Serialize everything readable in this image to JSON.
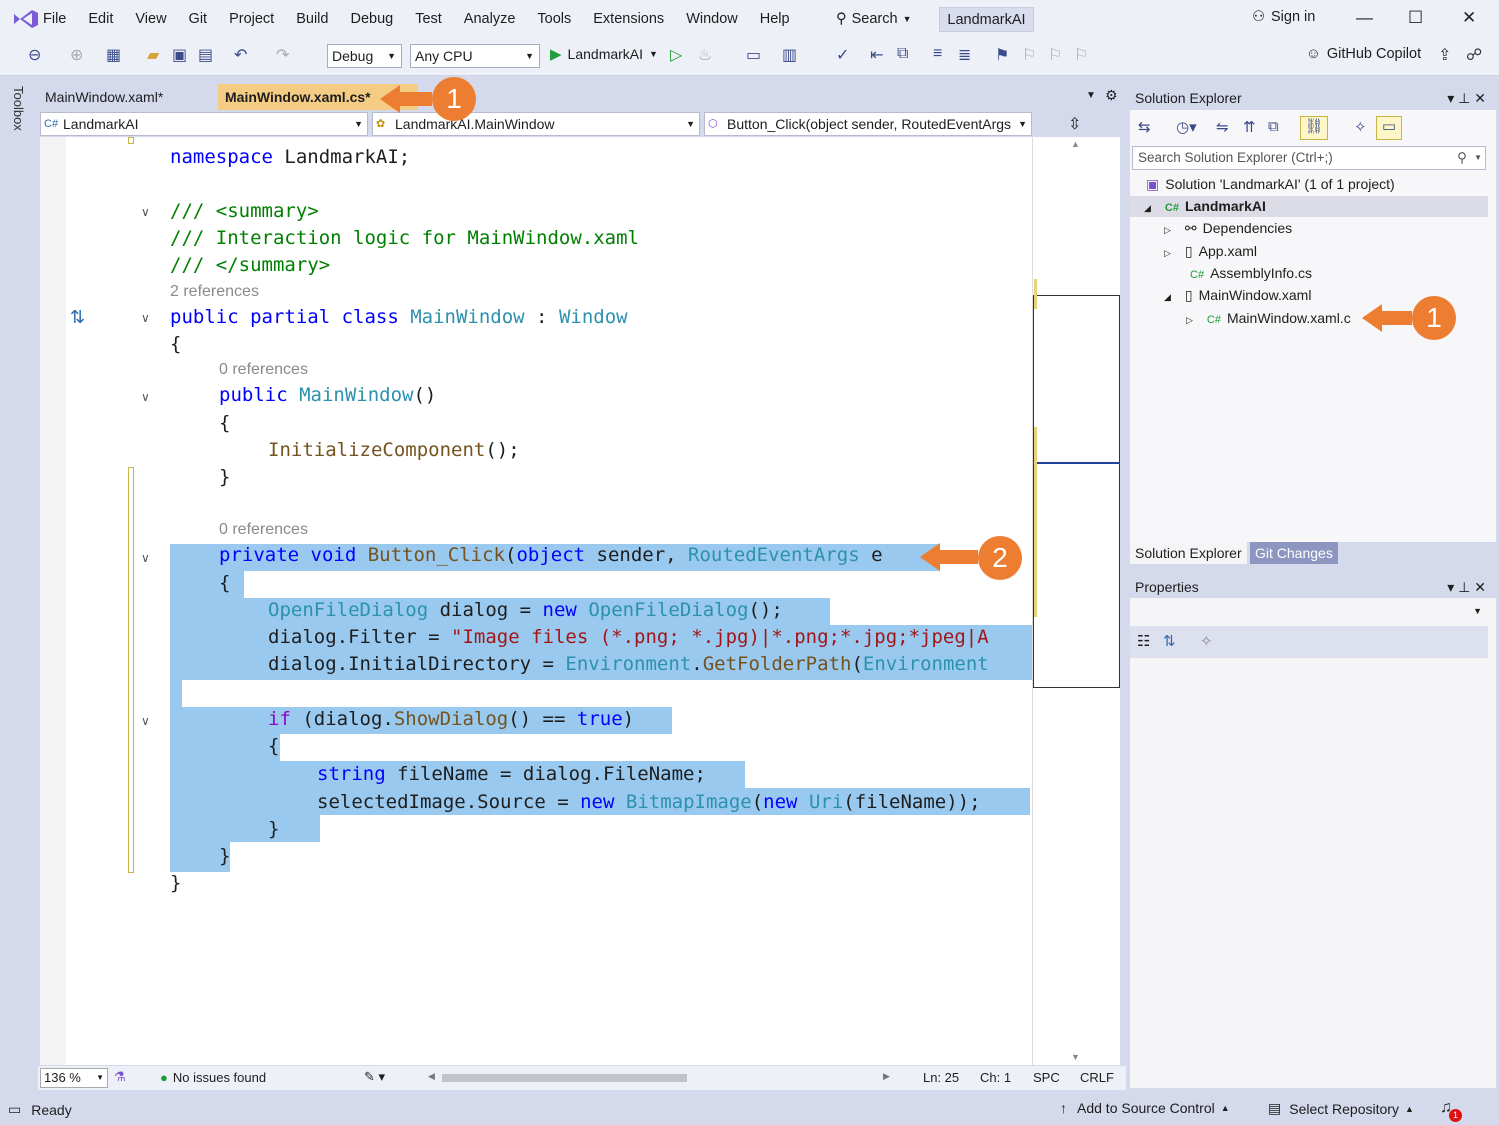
{
  "menu": [
    "File",
    "Edit",
    "View",
    "Git",
    "Project",
    "Build",
    "Debug",
    "Test",
    "Analyze",
    "Tools",
    "Extensions",
    "Window",
    "Help"
  ],
  "search_label": "Search",
  "solution_name": "LandmarkAI",
  "sign_in": "Sign in",
  "toolbar": {
    "config": "Debug",
    "platform": "Any CPU",
    "run_target": "LandmarkAI",
    "copilot": "GitHub Copilot"
  },
  "toolbox_label": "Toolbox",
  "tabs": [
    {
      "label": "MainWindow.xaml*"
    },
    {
      "label": "MainWindow.xaml.cs*"
    }
  ],
  "nav": {
    "project": "LandmarkAI",
    "type": "LandmarkAI.MainWindow",
    "member": "Button_Click(object sender, RoutedEventArgs"
  },
  "code": {
    "l1": [
      "namespace ",
      "LandmarkAI;"
    ],
    "l2": "/// <summary>",
    "l3": "/// Interaction logic for MainWindow.xaml",
    "l4": "/// </summary>",
    "ref2": "2 references",
    "l5": [
      "public partial class ",
      "MainWindow",
      " : ",
      "Window"
    ],
    "brace_open": "{",
    "brace_close": "}",
    "ref0a": "0 references",
    "l6": [
      "public ",
      "MainWindow",
      "()"
    ],
    "l7": [
      "InitializeComponent",
      "();"
    ],
    "ref0b": "0 references",
    "l8": [
      "private void ",
      "Button_Click",
      "(",
      "object",
      " sender, ",
      "RoutedEventArgs",
      " e"
    ],
    "l9": [
      "OpenFileDialog",
      " dialog = ",
      "new ",
      "OpenFileDialog",
      "();"
    ],
    "l10": [
      "dialog.Filter = ",
      "\"Image files (*.png; *.jpg)|*.png;*.jpg;*jpeg|A"
    ],
    "l11": [
      "dialog.InitialDirectory = ",
      "Environment",
      ".",
      "GetFolderPath",
      "(",
      "Environment"
    ],
    "l12": [
      "if",
      " (dialog.",
      "ShowDialog",
      "() == ",
      "true",
      ")"
    ],
    "l13": [
      "string",
      " fileName = dialog.FileName;"
    ],
    "l14": [
      "selectedImage.Source = ",
      "new ",
      "BitmapImage",
      "(",
      "new ",
      "Uri",
      "(fileName));"
    ]
  },
  "editor_status": {
    "zoom": "136 %",
    "issues": "No issues found",
    "ln": "Ln: 25",
    "ch": "Ch: 1",
    "spc": "SPC",
    "crlf": "CRLF"
  },
  "status": {
    "ready": "Ready",
    "add_source": "Add to Source Control",
    "select_repo": "Select Repository",
    "notif_count": "1"
  },
  "solution_explorer": {
    "title": "Solution Explorer",
    "search_placeholder": "Search Solution Explorer (Ctrl+;)",
    "items": [
      "Solution 'LandmarkAI' (1 of 1 project)",
      "LandmarkAI",
      "Dependencies",
      "App.xaml",
      "AssemblyInfo.cs",
      "MainWindow.xaml",
      "MainWindow.xaml.c"
    ],
    "tabs": [
      "Solution Explorer",
      "Git Changes"
    ]
  },
  "properties": {
    "title": "Properties"
  },
  "callouts": [
    "1",
    "2",
    "1"
  ],
  "colors": {
    "accent": "#ed7d31",
    "selection": "#99c9ef",
    "keyword": "#0000ff",
    "type": "#2b91af",
    "comment": "#008000",
    "string": "#a31515"
  }
}
